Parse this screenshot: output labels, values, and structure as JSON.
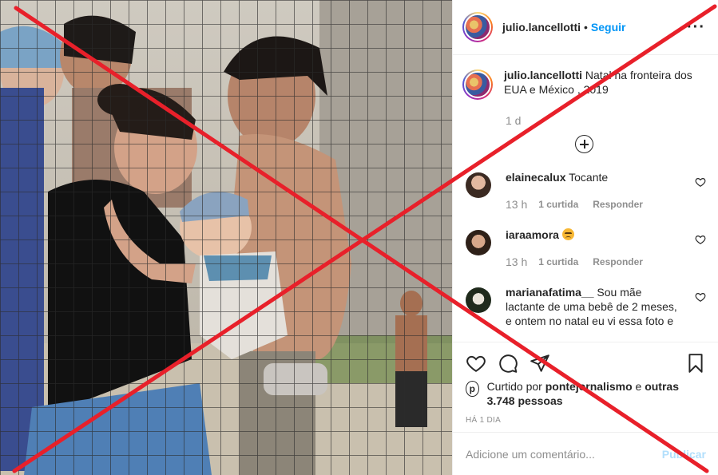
{
  "post": {
    "author": "julio.lancellotti",
    "separator": "•",
    "follow_label": "Seguir",
    "more_icon": "more-options-icon",
    "caption_text": "Natal na fronteira dos EUA e México , 2019",
    "caption_time": "1 d"
  },
  "comments": [
    {
      "user": "elainecalux",
      "text": "Tocante",
      "time": "13 h",
      "likes": "1 curtida",
      "reply": "Responder",
      "avatar_color": "#6b4b3a"
    },
    {
      "user": "iaraamora",
      "text": "",
      "emoji": "angry-face-icon",
      "time": "13 h",
      "likes": "1 curtida",
      "reply": "Responder",
      "avatar_color": "#8a5a44"
    },
    {
      "user": "marianafatima__",
      "text": "Sou mãe lactante de uma bebê de 2 meses, e ontem no natal eu vi essa foto e",
      "avatar_color": "#4a6a3a"
    }
  ],
  "likes_summary": {
    "prefix": "Curtido por",
    "user": "pontejornalismo",
    "connector": "e",
    "others": "outras 3.748 pessoas",
    "posted": "HÁ 1 DIA"
  },
  "add_comment": {
    "placeholder": "Adicione um comentário...",
    "publish_label": "Publicar"
  },
  "colors": {
    "link_blue": "#0095f6",
    "publish_disabled": "#b2dffc",
    "cross_red": "#e8202a",
    "muted": "#8e8e8e"
  }
}
